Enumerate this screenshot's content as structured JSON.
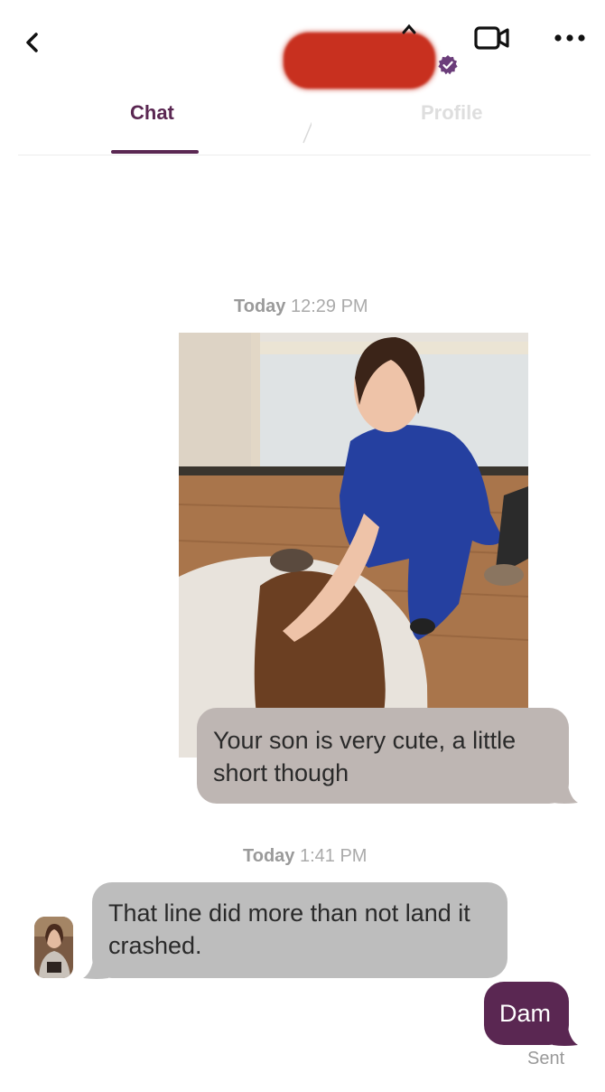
{
  "header": {
    "back_icon": "chevron-left-icon",
    "video_icon": "video-call-icon",
    "more_icon": "more-dots-icon",
    "verified_icon": "verified-badge-icon",
    "accent_color": "#5a2752"
  },
  "tabs": [
    {
      "label": "Chat",
      "active": true
    },
    {
      "label": "Profile",
      "active": false
    }
  ],
  "messages": [
    {
      "time_day": "Today",
      "time": "12:29 PM"
    },
    {
      "direction": "out",
      "type": "photo",
      "alt": "photo"
    },
    {
      "direction": "out",
      "text": "Your son is very cute, a little short though"
    },
    {
      "time_day": "Today",
      "time": "1:41 PM"
    },
    {
      "direction": "in",
      "text": "That line did more than not land it crashed."
    },
    {
      "direction": "out",
      "text": "Dam",
      "status": "Sent"
    }
  ]
}
